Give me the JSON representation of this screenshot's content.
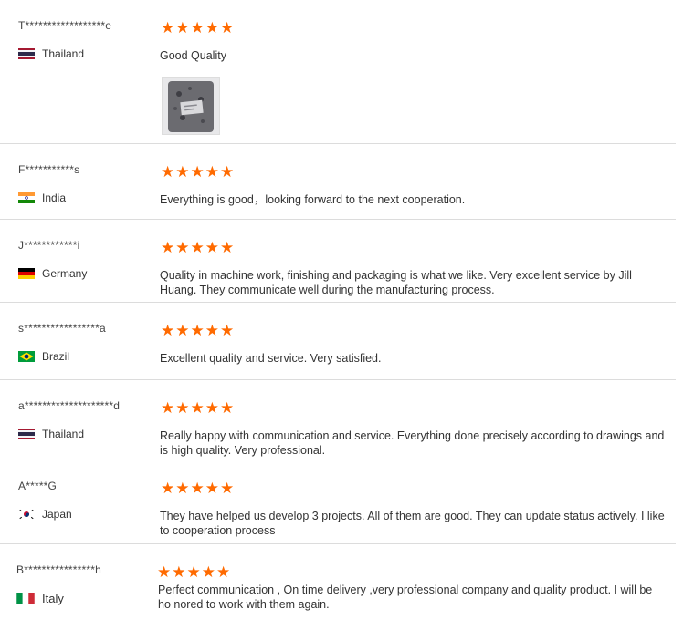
{
  "reviews": [
    {
      "name": "T******************e",
      "country": "Thailand",
      "flag": "thailand",
      "stars": 5,
      "text": "Good Quality",
      "has_image": true
    },
    {
      "name": "F***********s",
      "country": "India",
      "flag": "india",
      "stars": 5,
      "text": "Everything is good，looking forward to the next cooperation.",
      "has_image": false
    },
    {
      "name": "J************i",
      "country": "Germany",
      "flag": "germany",
      "stars": 5,
      "text": "Quality in machine work, finishing and packaging is what we like. Very excellent service by Jill Huang. They communicate well during the manufacturing process.",
      "has_image": false
    },
    {
      "name": "s*****************a",
      "country": "Brazil",
      "flag": "brazil",
      "stars": 5,
      "text": "Excellent quality and service. Very satisfied.",
      "has_image": false
    },
    {
      "name": "a********************d",
      "country": "Thailand",
      "flag": "thailand",
      "stars": 5,
      "text": "Really happy with communication and service. Everything done precisely according to drawings and is high quality. Very professional.",
      "has_image": false
    },
    {
      "name": "A*****G",
      "country": "Japan",
      "flag": "korea",
      "stars": 5,
      "text": "They have helped us develop 3 projects. All of them are good. They can update status actively. I like to cooperation process",
      "has_image": false
    },
    {
      "name": "B****************h",
      "country": "Italy",
      "flag": "italy",
      "stars": 5,
      "text": "Perfect communication , On time delivery ,very professional company and quality product. I will be ho nored to work with them again.",
      "has_image": false
    }
  ],
  "colors": {
    "star": "#ff6a00",
    "divider": "#dcdcdc"
  },
  "icons": {
    "star": "star-icon",
    "image": "review-photo-thumbnail"
  }
}
